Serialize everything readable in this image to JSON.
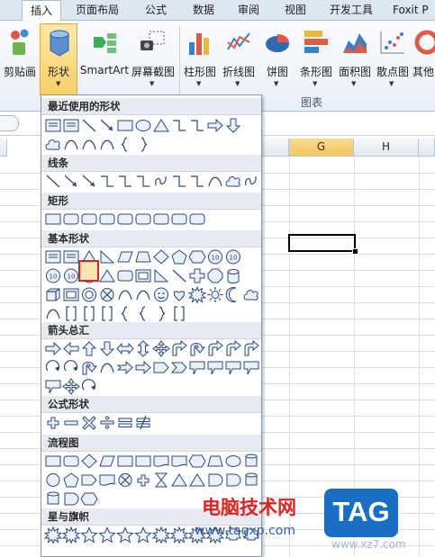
{
  "tabs": [
    "插入",
    "页面布局",
    "公式",
    "数据",
    "审阅",
    "视图",
    "开发工具",
    "Foxit P"
  ],
  "active_tab": "插入",
  "ribbon": {
    "clipboard_label": "剪贴画",
    "shapes_label": "形状",
    "smartart_label": "SmartArt",
    "screenshot_label": "屏幕截图",
    "charts": [
      "柱形图",
      "折线图",
      "饼图",
      "条形图",
      "面积图",
      "散点图",
      "其他"
    ],
    "charts_group_label": "图表"
  },
  "sheet": {
    "columns": [
      "G",
      "H"
    ],
    "selected_column": "G"
  },
  "shapes_menu": {
    "sections": [
      {
        "title": "最近使用的形状"
      },
      {
        "title": "线条"
      },
      {
        "title": "矩形"
      },
      {
        "title": "基本形状"
      },
      {
        "title": "箭头总汇"
      },
      {
        "title": "公式形状"
      },
      {
        "title": "流程图"
      },
      {
        "title": "星与旗帜"
      }
    ],
    "highlighted_shape": "chord-shape"
  },
  "watermark": {
    "site_cn": "电脑技术网",
    "url": "www.tagxp.com",
    "logo": "TAG",
    "url2": "www.xz7.com"
  },
  "colors": {
    "accent": "#2f6bb0",
    "highlight_red": "#e02020",
    "tab_logo_blue": "#1a6fc4"
  }
}
